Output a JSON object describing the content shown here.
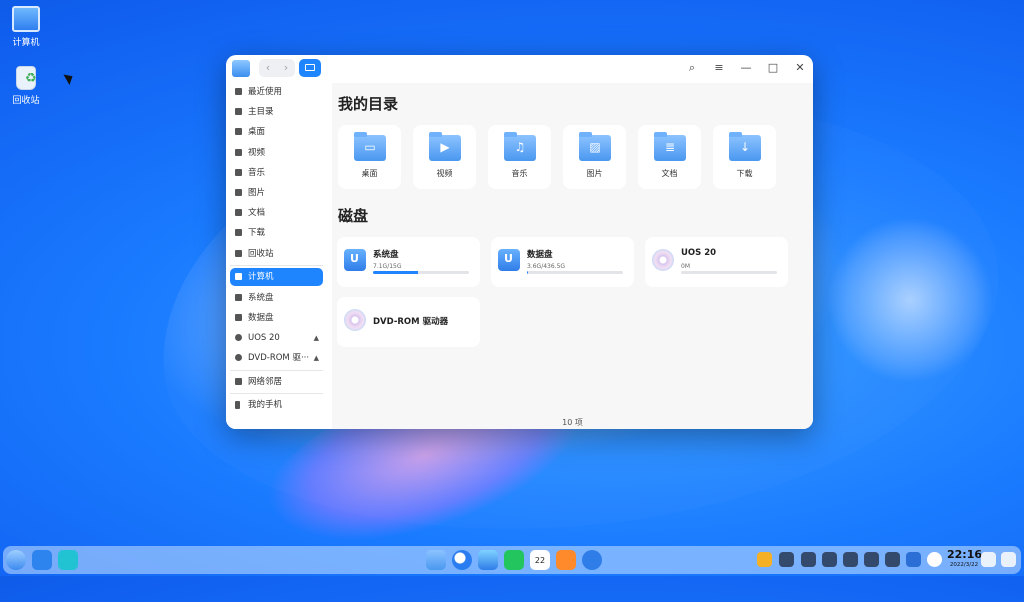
{
  "desktop": {
    "icons": [
      {
        "label": "计算机",
        "icon": "computer-icon"
      },
      {
        "label": "回收站",
        "icon": "trash-icon"
      }
    ]
  },
  "window": {
    "title_icon": "file-manager-icon",
    "controls": {
      "search": "⌕",
      "menu": "≡",
      "minimize": "—",
      "maximize": "□",
      "close": "✕"
    },
    "nav": {
      "back": "‹",
      "forward": "›"
    }
  },
  "sidebar": {
    "items": [
      {
        "label": "最近使用",
        "icon": "clock-icon"
      },
      {
        "label": "主目录",
        "icon": "home-icon"
      },
      {
        "label": "桌面",
        "icon": "desktop-icon"
      },
      {
        "label": "视频",
        "icon": "video-icon"
      },
      {
        "label": "音乐",
        "icon": "music-icon"
      },
      {
        "label": "图片",
        "icon": "picture-icon"
      },
      {
        "label": "文档",
        "icon": "document-icon"
      },
      {
        "label": "下载",
        "icon": "download-icon"
      },
      {
        "label": "回收站",
        "icon": "trash-icon"
      },
      {
        "label": "计算机",
        "icon": "computer-icon",
        "active": true
      },
      {
        "label": "系统盘",
        "icon": "disk-icon"
      },
      {
        "label": "数据盘",
        "icon": "disk-icon"
      },
      {
        "label": "UOS 20",
        "icon": "optical-icon",
        "eject": "▲"
      },
      {
        "label": "DVD-ROM 驱···",
        "icon": "optical-icon",
        "eject": "▲"
      },
      {
        "label": "网络邻居",
        "icon": "network-icon"
      },
      {
        "label": "我的手机",
        "icon": "phone-icon"
      }
    ]
  },
  "main": {
    "my_dirs_title": "我的目录",
    "dirs": [
      {
        "label": "桌面",
        "symbol": "▭"
      },
      {
        "label": "视频",
        "symbol": "▶"
      },
      {
        "label": "音乐",
        "symbol": "♫"
      },
      {
        "label": "图片",
        "symbol": "▨"
      },
      {
        "label": "文档",
        "symbol": "≣"
      },
      {
        "label": "下载",
        "symbol": "↓"
      }
    ],
    "disks_title": "磁盘",
    "disks": [
      {
        "name": "系统盘",
        "size": "7.1G/15G",
        "used_fraction": 0.47,
        "type": "hdd"
      },
      {
        "name": "数据盘",
        "size": "3.6G/436.5G",
        "used_fraction": 0.01,
        "type": "hdd"
      },
      {
        "name": "UOS 20",
        "size": "0M",
        "used_fraction": 0,
        "type": "optical"
      },
      {
        "name": "DVD-ROM 驱动器",
        "size": "",
        "type": "optical"
      }
    ],
    "status": "10 项"
  },
  "taskbar": {
    "clock_time": "22:16",
    "clock_date": "2022/3/22",
    "calendar_day": "22",
    "accent": "#1f85ff"
  }
}
